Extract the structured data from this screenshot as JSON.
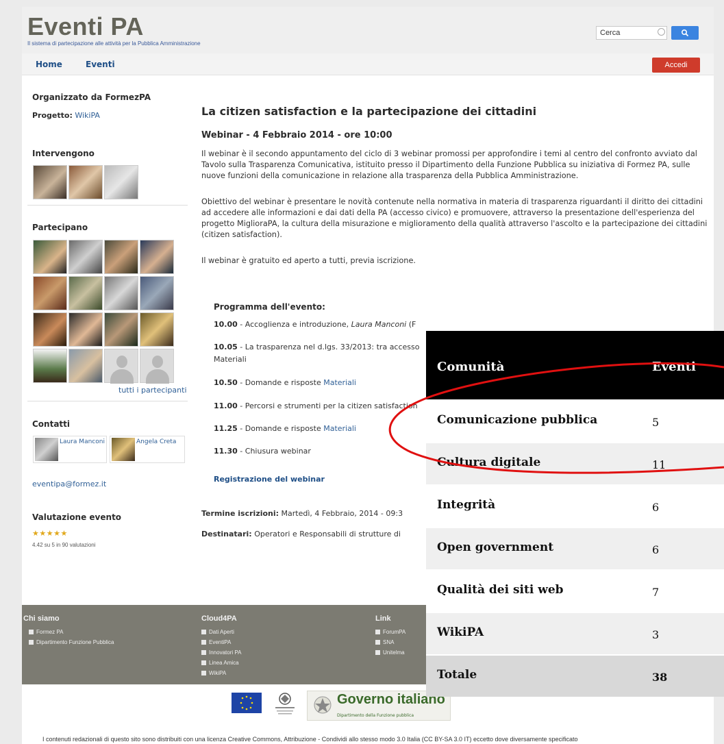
{
  "header": {
    "title": "Eventi PA",
    "subtitle": "Il sistema di partecipazione alle attività per la Pubblica Amministrazione",
    "search_value": "Cerca"
  },
  "nav": {
    "home": "Home",
    "eventi": "Eventi",
    "login": "Accedi"
  },
  "sidebar": {
    "organized_by": "Organizzato da FormezPA",
    "project_label": "Progetto:",
    "project_value": "WikiPA",
    "speakers_heading": "Intervengono",
    "participants_heading": "Partecipano",
    "all_participants": "tutti i partecipanti",
    "contacts_heading": "Contatti",
    "contact1_name": "Laura Manconi",
    "contact2_name": "Angela Creta",
    "email": "eventipa@formez.it",
    "rating_heading": "Valutazione evento",
    "rating_stars": "★★★★★",
    "rating_text": "4.42 su 5 in 90 valutazioni",
    "rating_value": 4.42,
    "rating_max": 5,
    "rating_count": 90
  },
  "main": {
    "title": "La citizen satisfaction e la partecipazione dei cittadini",
    "subtitle": "Webinar - 4 Febbraio 2014 - ore 10:00",
    "para1": "Il webinar è il secondo appuntamento del ciclo di 3 webinar  promossi per approfondire i temi al centro del confronto avviato dal Tavolo sulla Trasparenza Comunicativa, istituito presso il Dipartimento della Funzione Pubblica su iniziativa di Formez PA, sulle nuove funzioni della comunicazione in relazione alla trasparenza della Pubblica Amministrazione.",
    "para2": "Obiettivo del webinar è presentare le novità contenute nella normativa in materia di trasparenza riguardanti il diritto dei cittadini ad accedere alle informazioni e dai dati della PA (accesso civico) e promuovere, attraverso la presentazione dell'esperienza del progetto MiglioraPA, la cultura della misurazione e miglioramento della qualità attraverso l'ascolto e la partecipazione dei cittadini (citizen satisfaction).",
    "para3": "Il webinar è gratuito ed aperto a tutti, previa iscrizione.",
    "program_heading": "Programma dell'evento:",
    "p1_time": "10.00",
    "p1_text": " - Accoglienza e introduzione, ",
    "p1_speaker": "Laura Manconi",
    "p1_tail": " (F",
    "p2_time": "10.05",
    "p2_text": " - La trasparenza nel d.lgs. 33/2013: tra accesso",
    "p2_link": "Materiali",
    "p3_time": "10.50",
    "p3_text": " - Domande e risposte ",
    "p3_link": "Materiali",
    "p4_time": "11.00",
    "p4_text": " - Percorsi e strumenti per la citizen satisfaction",
    "p5_time": "11.25",
    "p5_text": " - Domande e risposte ",
    "p5_link": "Materiali",
    "p6_time": "11.30",
    "p6_text": " - Chiusura webinar",
    "register": "Registrazione del webinar",
    "deadline_label": "Termine iscrizioni:",
    "deadline_value": " Martedì, 4 Febbraio, 2014 - 09:3",
    "audience_label": "Destinatari:",
    "audience_value": " Operatori e Responsabili di strutture di"
  },
  "footer": {
    "col1_heading": "Chi siamo",
    "col1_items": [
      "Formez PA",
      "Dipartimento Funzione Pubblica"
    ],
    "col2_heading": "Cloud4PA",
    "col2_items": [
      "Dati Aperti",
      "EventiPA",
      "Innovatori PA",
      "Linea Amica",
      "WikiPA"
    ],
    "col3_heading": "Link",
    "col3_items": [
      "ForumPA",
      "SNA",
      "Unitelma"
    ],
    "gov_logo": "Governo italiano",
    "gov_sub": "Dipartimento della Funzione pubblica",
    "license_text": "I contenuti redazionali di questo sito sono distribuiti con una licenza Creative Commons, Attribuzione - Condividi allo stesso modo 3.0 Italia (CC BY-SA 3.0 IT) eccetto dove diversamente specificato"
  },
  "overlay": {
    "col1": "Comunità",
    "col2": "Eventi",
    "rows": [
      {
        "name": "Comunicazione pubblica",
        "value": "5"
      },
      {
        "name": "Cultura digitale",
        "value": "11"
      },
      {
        "name": "Integrità",
        "value": "6"
      },
      {
        "name": "Open government",
        "value": "6"
      },
      {
        "name": "Qualità dei siti web",
        "value": "7"
      },
      {
        "name": "WikiPA",
        "value": "3"
      },
      {
        "name": "Totale",
        "value": "38"
      }
    ],
    "annotation_color": "#e01010"
  }
}
